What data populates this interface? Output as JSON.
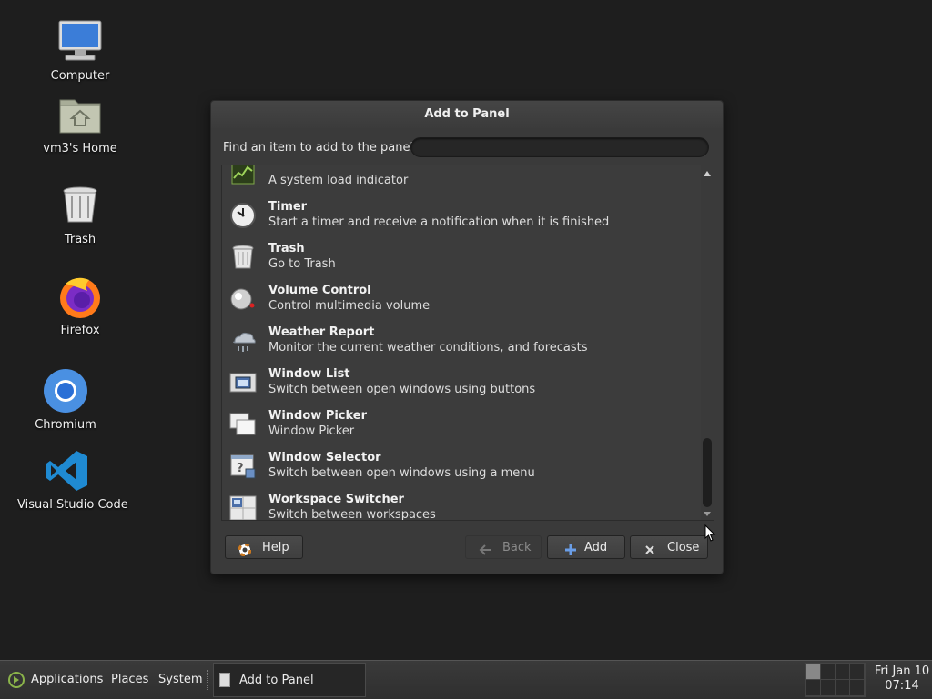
{
  "desktop": {
    "icons": [
      {
        "label": "Computer",
        "icon": "computer-icon"
      },
      {
        "label": "vm3's Home",
        "icon": "home-folder-icon"
      },
      {
        "label": "Trash",
        "icon": "trash-icon"
      },
      {
        "label": "Firefox",
        "icon": "firefox-icon"
      },
      {
        "label": "Chromium",
        "icon": "chromium-icon"
      },
      {
        "label": "Visual Studio Code",
        "icon": "vscode-icon"
      }
    ]
  },
  "dialog": {
    "title": "Add to Panel",
    "find_label": "Find an item to add to the panel:",
    "find_value": "",
    "items": [
      {
        "name": "",
        "desc": "A system load indicator",
        "icon": "system-monitor-icon"
      },
      {
        "name": "Timer",
        "desc": "Start a timer and receive a notification when it is finished",
        "icon": "timer-icon"
      },
      {
        "name": "Trash",
        "desc": "Go to Trash",
        "icon": "trash-icon"
      },
      {
        "name": "Volume Control",
        "desc": "Control multimedia volume",
        "icon": "volume-icon"
      },
      {
        "name": "Weather Report",
        "desc": "Monitor the current weather conditions, and forecasts",
        "icon": "weather-icon"
      },
      {
        "name": "Window List",
        "desc": "Switch between open windows using buttons",
        "icon": "window-list-icon"
      },
      {
        "name": "Window Picker",
        "desc": "Window Picker",
        "icon": "window-picker-icon"
      },
      {
        "name": "Window Selector",
        "desc": "Switch between open windows using a menu",
        "icon": "window-selector-icon"
      },
      {
        "name": "Workspace Switcher",
        "desc": "Switch between workspaces",
        "icon": "workspace-switcher-icon"
      }
    ],
    "buttons": {
      "help": "Help",
      "back": "Back",
      "add": "Add",
      "close": "Close"
    }
  },
  "taskbar": {
    "menus": [
      "Applications",
      "Places",
      "System"
    ],
    "task": "Add to Panel",
    "clock_date": "Fri Jan 10",
    "clock_time": "07:14"
  }
}
